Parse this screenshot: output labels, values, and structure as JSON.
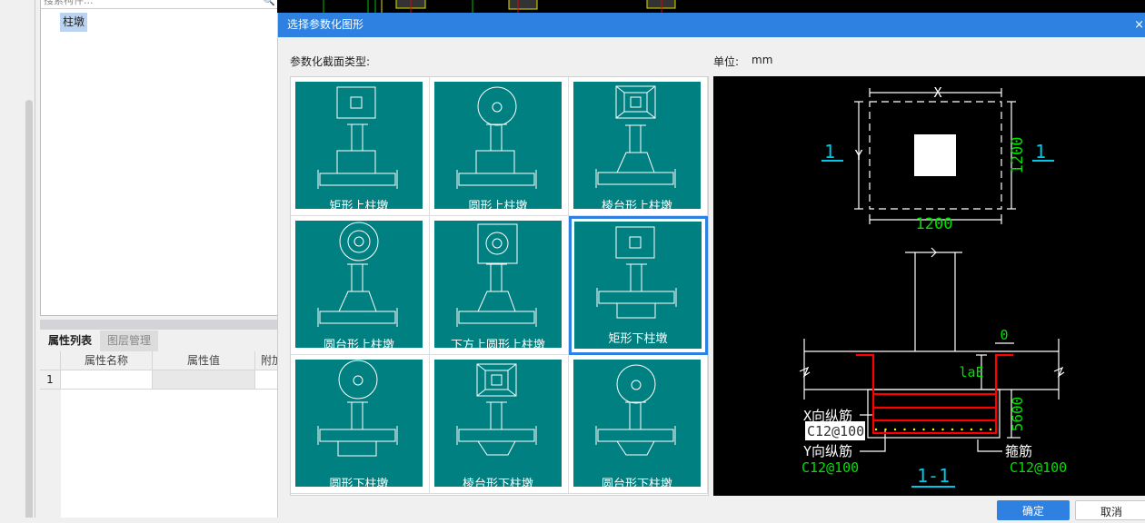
{
  "left_panel": {
    "search_placeholder": "搜索构件...",
    "tree_item": "柱墩",
    "tabs": [
      {
        "label": "属性列表",
        "active": true
      },
      {
        "label": "图层管理",
        "active": false
      }
    ],
    "table": {
      "headers": [
        "",
        "属性名称",
        "属性值",
        "附加"
      ],
      "rows": [
        [
          "1",
          "",
          "",
          ""
        ]
      ]
    }
  },
  "dialog": {
    "title": "选择参数化图形",
    "close": "×",
    "type_label": "参数化截面类型:",
    "unit_label": "单位:",
    "unit_value": "mm",
    "options": [
      {
        "label": "矩形上柱墩",
        "top": "rect",
        "base": "rect-up"
      },
      {
        "label": "圆形上柱墩",
        "top": "circle",
        "base": "rect-up"
      },
      {
        "label": "棱台形上柱墩",
        "top": "pyramid",
        "base": "frustum-up"
      },
      {
        "label": "圆台形上柱墩",
        "top": "cone",
        "base": "frustum-up"
      },
      {
        "label": "下方上圆形上柱墩",
        "top": "square-circle",
        "base": "frustum-up"
      },
      {
        "label": "矩形下柱墩",
        "top": "rect",
        "base": "rect-down"
      },
      {
        "label": "圆形下柱墩",
        "top": "circle-small",
        "base": "rect-down"
      },
      {
        "label": "棱台形下柱墩",
        "top": "pyramid",
        "base": "frustum-down"
      },
      {
        "label": "圆台形下柱墩",
        "top": "circle",
        "base": "frustum-down"
      }
    ],
    "selected_index": 5,
    "preview": {
      "dim_x": "X",
      "dim_y": "Y",
      "width": "1200",
      "height": "1200",
      "section_mark": "1",
      "section_title": "1-1",
      "anchor": "laE",
      "offset": "0",
      "depth": "5600",
      "x_rebar_label": "X向纵筋",
      "x_rebar_value": "C12@100",
      "y_rebar_label": "Y向纵筋",
      "y_rebar_value": "C12@100",
      "stirrup_label": "箍筋",
      "stirrup_value": "C12@100"
    },
    "ok": "确定",
    "cancel": "取消"
  },
  "colors": {
    "accent": "#2e81e0",
    "tile": "#008080",
    "green": "#00e000",
    "cyan": "#00c8e8",
    "rebar": "#ff0000"
  }
}
